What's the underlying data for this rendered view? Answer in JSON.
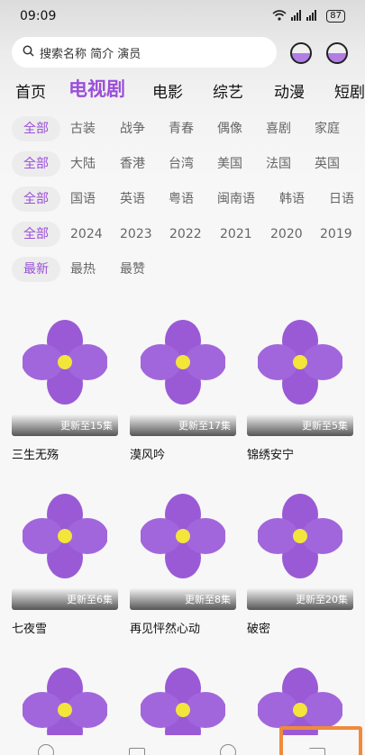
{
  "status": {
    "time": "09:09",
    "network": "4G 4G",
    "battery": "87"
  },
  "search": {
    "placeholder": "搜索名称 简介 演员"
  },
  "main_tabs": [
    "首页",
    "电视剧",
    "电影",
    "综艺",
    "动漫",
    "短剧"
  ],
  "active_tab": "电视剧",
  "filters": [
    [
      "全部",
      "古装",
      "战争",
      "青春",
      "偶像",
      "喜剧",
      "家庭"
    ],
    [
      "全部",
      "大陆",
      "香港",
      "台湾",
      "美国",
      "法国",
      "英国"
    ],
    [
      "全部",
      "国语",
      "英语",
      "粤语",
      "闽南语",
      "韩语",
      "日语"
    ],
    [
      "全部",
      "2024",
      "2023",
      "2022",
      "2021",
      "2020",
      "2019"
    ],
    [
      "最新",
      "最热",
      "最赞"
    ]
  ],
  "accent_color": "#9b4fd8",
  "cards": [
    {
      "title": "三生无殇",
      "update": "更新至15集"
    },
    {
      "title": "漠风吟",
      "update": "更新至17集"
    },
    {
      "title": "锦绣安宁",
      "update": "更新至5集"
    },
    {
      "title": "七夜雪",
      "update": "更新至6集"
    },
    {
      "title": "再见怦然心动",
      "update": "更新至8集"
    },
    {
      "title": "破密",
      "update": "更新至20集"
    },
    {
      "title": "",
      "update": ""
    },
    {
      "title": "",
      "update": ""
    },
    {
      "title": "",
      "update": ""
    }
  ]
}
